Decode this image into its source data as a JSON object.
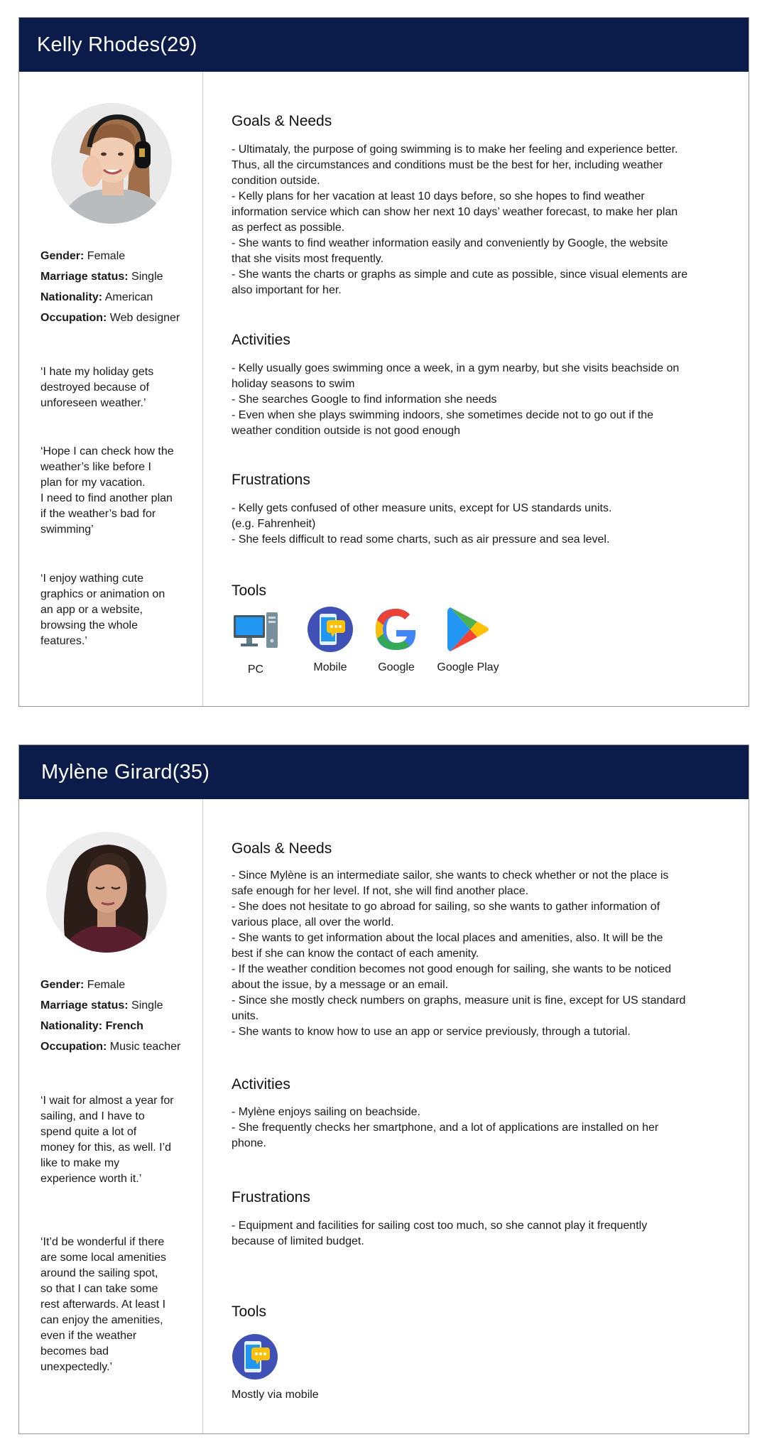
{
  "personas": [
    {
      "name": "Kelly Rhodes(29)",
      "details": {
        "gender_label": "Gender:",
        "gender": " Female",
        "marriage_label": "Marriage status:",
        "marriage": " Single",
        "nationality_label": "Nationality:",
        "nationality": " American",
        "occupation_label": "Occupation:",
        "occupation": " Web designer"
      },
      "quotes": [
        "‘I hate my holiday gets\ndestroyed because of\nunforeseen weather.’",
        "‘Hope I can check how the\nweather’s like before I\nplan for my vacation.\nI need to find another plan\nif the weather’s bad for\nswimming’",
        "‘I enjoy wathing cute\ngraphics or animation on\nan app or a website,\nbrowsing the whole\nfeatures.’"
      ],
      "goals_title": "Goals & Needs",
      "goals_text": "- Ultimataly, the purpose of going swimming is to make her feeling and experience better.\nThus, all the circumstances and conditions must be the best for her, including weather\ncondition outside.\n- Kelly plans for her vacation at least 10 days before, so she hopes to find weather\ninformation service which can show her next 10 days’ weather forecast, to make her plan\nas perfect as possible.\n- She wants to find weather information easily and conveniently by Google, the website\nthat she visits most frequently.\n- She wants the charts or graphs as simple and cute as possible, since visual elements are\nalso important for her.",
      "activities_title": "Activities",
      "activities_text": "- Kelly usually goes swimming once a week, in a gym nearby, but she visits beachside on\nholiday seasons to swim\n- She searches Google to find information she needs\n- Even when she plays swimming indoors, she sometimes decide not to go out if the\nweather condition outside is not good enough",
      "frustrations_title": "Frustrations",
      "frustrations_text": "- Kelly gets confused of other measure units, except for US standards units.\n(e.g. Fahrenheit)\n- She feels difficult to read some charts, such as air pressure and sea level.",
      "tools_title": "Tools",
      "tools": [
        {
          "label": "PC",
          "icon": "desktop-pc-icon"
        },
        {
          "label": "Mobile",
          "icon": "mobile-chat-icon"
        },
        {
          "label": "Google",
          "icon": "google-icon"
        },
        {
          "label": "Google Play",
          "icon": "google-play-icon"
        }
      ]
    },
    {
      "name": "Mylène Girard(35)",
      "details": {
        "gender_label": "Gender:",
        "gender": " Female",
        "marriage_label": "Marriage status:",
        "marriage": " Single",
        "nationality_label": "Nationality:",
        "nationality": " French",
        "occupation_label": "Occupation:",
        "occupation": " Music teacher"
      },
      "quotes": [
        "‘I wait for almost a year for\nsailing, and I have to\nspend quite a lot of\nmoney for this, as well. I’d\nlike to make my\nexperience worth it.’",
        "‘It’d be wonderful if there\nare some local amenities\naround the sailing spot,\nso that I can take some\nrest afterwards. At least I\ncan enjoy the amenities,\neven if the weather\nbecomes bad\nunexpectedly.’"
      ],
      "goals_title": "Goals & Needs",
      "goals_text": "- Since Mylène is an intermediate sailor, she wants to check whether or not the place is\nsafe enough for her level. If not, she will find another place.\n- She does not hesitate to go abroad for sailing, so she wants to gather information of\nvarious place, all over the world.\n- She wants to get information about the local places and amenities, also. It will be the\nbest if she can know the contact of each amenity.\n- If the weather condition becomes not good enough for sailing, she wants to be noticed\nabout the issue, by a message or an email.\n- Since she mostly check numbers on graphs, measure unit is fine, except for US standard\nunits.\n- She wants to know how to use an app or service previously, through a  tutorial.",
      "activities_title": "Activities",
      "activities_text": "- Mylène enjoys sailing on beachside.\n- She frequently checks her smartphone, and a lot of applications are installed on her\nphone.",
      "frustrations_title": "Frustrations",
      "frustrations_text": "- Equipment and facilities for sailing cost too much, so she cannot play it frequently\nbecause of limited budget.",
      "tools_title": "Tools",
      "tools": [
        {
          "label": "Mostly via mobile",
          "icon": "mobile-chat-icon"
        }
      ]
    }
  ],
  "colors": {
    "header_bg": "#0b1b4a",
    "header_text": "#ffffff"
  }
}
